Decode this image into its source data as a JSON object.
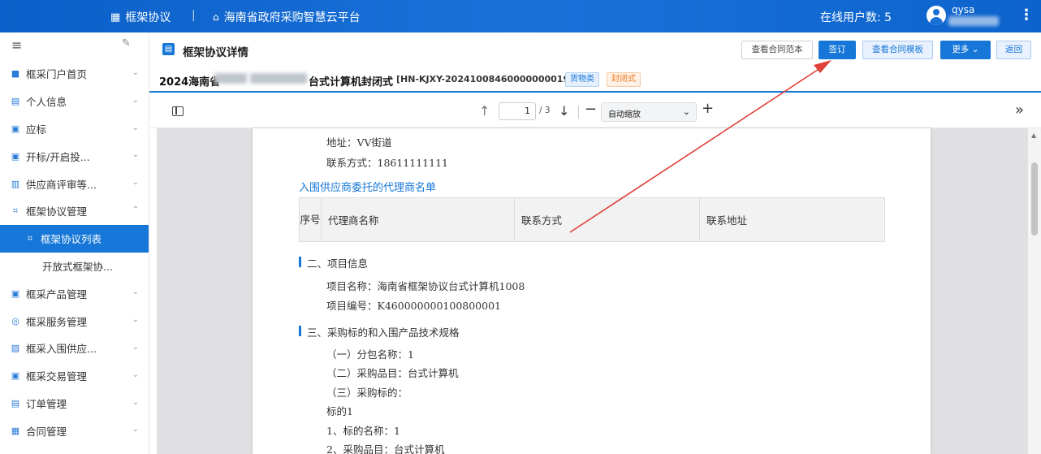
{
  "topbar": {
    "app_name": "框架协议",
    "separator": "|",
    "platform_name": "海南省政府采购智慧云平台",
    "online_users": "在线用户数: 5",
    "username": "qysa"
  },
  "sidebar": {
    "items": [
      {
        "icon": "grid-icon",
        "label": "框采门户首页",
        "arrow": "⌄"
      },
      {
        "icon": "id-card-icon",
        "label": "个人信息",
        "arrow": "⌄"
      },
      {
        "icon": "bid-icon",
        "label": "应标",
        "arrow": "⌄"
      },
      {
        "icon": "bid-open-icon",
        "label": "开标/开启投...",
        "arrow": "⌄"
      },
      {
        "icon": "review-icon",
        "label": "供应商评审等...",
        "arrow": "⌄"
      },
      {
        "icon": "agreement-icon",
        "label": "框架协议管理",
        "arrow": "⌃"
      },
      {
        "icon": "agreement-list-icon",
        "label": "框架协议列表"
      },
      {
        "label": "开放式框架协..."
      },
      {
        "icon": "product-icon",
        "label": "框采产品管理",
        "arrow": "⌄"
      },
      {
        "icon": "service-icon",
        "label": "框采服务管理",
        "arrow": "⌄"
      },
      {
        "icon": "supplier-icon",
        "label": "框采入围供应...",
        "arrow": "⌄"
      },
      {
        "icon": "trade-icon",
        "label": "框采交易管理",
        "arrow": "⌄"
      },
      {
        "icon": "order-icon",
        "label": "订单管理",
        "arrow": "⌄"
      },
      {
        "icon": "contract-icon",
        "label": "合同管理",
        "arrow": "⌄"
      }
    ]
  },
  "header": {
    "title": "框架协议详情",
    "buttons": {
      "view_sample": "查看合同范本",
      "sign": "签订",
      "view_template": "查看合同模板",
      "more": "更多 ⌄",
      "back": "返回"
    }
  },
  "project": {
    "title_prefix": "2024海南省",
    "title_suffix": "台式计算机封闭式",
    "code": "[HN-KJXY-20241008460000000019]",
    "tag1": "货物类",
    "tag2": "封闭式"
  },
  "pdf": {
    "page": "1",
    "total": "/ 3",
    "zoom": "自动缩放"
  },
  "document": {
    "address": "地址：VV街道",
    "contact": "联系方式：18611111111",
    "agent_heading": "入围供应商委托的代理商名单",
    "table_headers": {
      "seq": "序号",
      "agent_name": "代理商名称",
      "contact": "联系方式",
      "address": "联系地址"
    },
    "section2": "二、项目信息",
    "project_name": "项目名称：海南省框架协议台式计算机1008",
    "project_code": "项目编号：K460000000100800001",
    "section3": "三、采购标的和入围产品技术规格",
    "item1": "（一）分包名称：1",
    "item2": "（二）采购品目：台式计算机",
    "item3": "（三）采购标的：",
    "item4": "标的1",
    "item5": "1、标的名称：1",
    "item6": "2、采购品目：台式计算机"
  },
  "colors": {
    "primary": "#1677d8",
    "arrow": "#e0403a"
  }
}
